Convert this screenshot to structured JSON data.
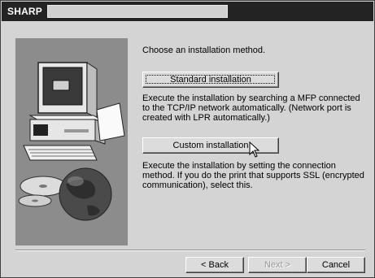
{
  "window": {
    "title": "SHARP",
    "title_field_value": ""
  },
  "main": {
    "intro": "Choose an installation method.",
    "standard_label": "Standard installation",
    "standard_desc": "Execute the installation by searching a MFP connected to the TCP/IP network automatically.  (Network port is created with LPR automatically.)",
    "custom_label": "Custom installation",
    "custom_desc": "Execute the installation by setting the connection method. If you do the print that supports SSL (encrypted communication), select this."
  },
  "footer": {
    "back_label": "< Back",
    "next_label": "Next >",
    "cancel_label": "Cancel"
  },
  "icons": [
    "computer-illustration",
    "cd-disc-illustration",
    "globe-illustration",
    "mouse-pointer-icon"
  ]
}
